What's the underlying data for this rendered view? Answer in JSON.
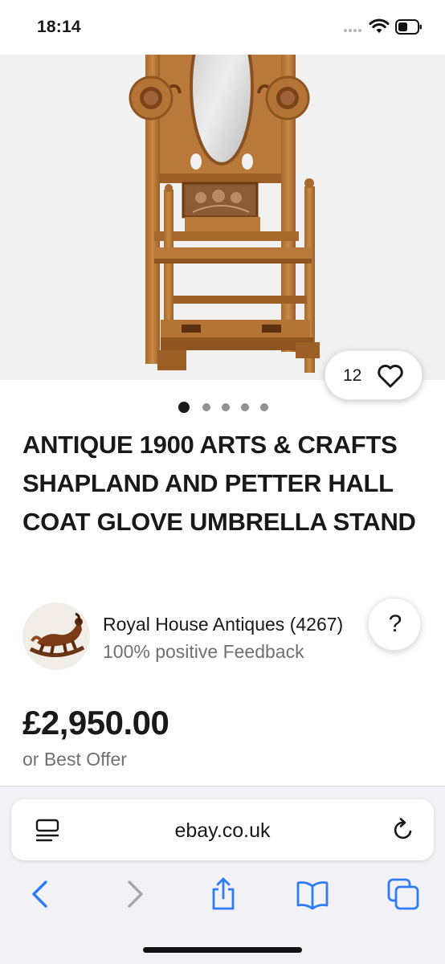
{
  "status_bar": {
    "time": "18:14"
  },
  "listing": {
    "watch_count": "12",
    "image_count": 5,
    "active_image_index": 0,
    "title": "ANTIQUE 1900 ARTS & CRAFTS SHAPLAND AND PETTER HALL COAT GLOVE UMBRELLA STAND",
    "seller": {
      "name": "Royal House Antiques (4267)",
      "feedback": "100% positive Feedback"
    },
    "price": "£2,950.00",
    "price_note": "or Best Offer",
    "help_label": "?"
  },
  "browser": {
    "url": "ebay.co.uk",
    "reader_icon": "page-menu-icon",
    "reload_icon": "reload-icon",
    "toolbar": [
      "back-icon",
      "forward-icon",
      "share-icon",
      "bookmarks-icon",
      "tabs-icon"
    ]
  },
  "colors": {
    "accent_blue": "#2f7bf5",
    "disabled_gray": "#a7a7ab",
    "text_primary": "#191919",
    "text_secondary": "#707070"
  }
}
